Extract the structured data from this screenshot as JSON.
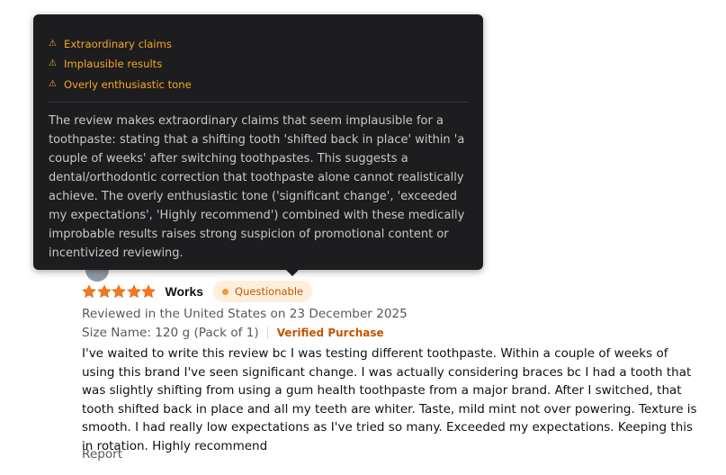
{
  "tooltip": {
    "flags": [
      {
        "icon": "warning-icon",
        "label": "Extraordinary claims"
      },
      {
        "icon": "warning-icon",
        "label": "Implausible results"
      },
      {
        "icon": "warning-icon",
        "label": "Overly enthusiastic tone"
      }
    ],
    "explanation": "The review makes extraordinary claims that seem implausible for a toothpaste: stating that a shifting tooth 'shifted back in place' within 'a couple of weeks' after switching toothpastes. This suggests a dental/orthodontic correction that toothpaste alone cannot realistically achieve. The overly enthusiastic tone ('significant change', 'exceeded my expectations', 'Highly recommend') combined with these medically improbable results raises strong suspicion of promotional content or incentivized reviewing.",
    "accent_color": "#f5a623"
  },
  "review": {
    "rating": 5,
    "rating_max": 5,
    "star_color": "#f4771f",
    "title": "Works",
    "badge": {
      "label": "Questionable",
      "color": "#c45500"
    },
    "date": "Reviewed in the United States on 23 December 2025",
    "size": "Size Name: 120 g (Pack of 1)",
    "verified": "Verified Purchase",
    "body": "I've waited to write this review bc I was testing different toothpaste. Within a couple of weeks of using this brand I've seen significant change. I was actually considering braces bc I had a tooth that was slightly shifting from using a gum health toothpaste from a major brand. After I switched, that tooth shifted back in place and all my teeth are whiter. Taste, mild mint not over powering. Texture is smooth. I had really low expectations as I've tried so many. Exceeded my expectations. Keeping this in rotation. Highly recommend",
    "report_label": "Report"
  }
}
